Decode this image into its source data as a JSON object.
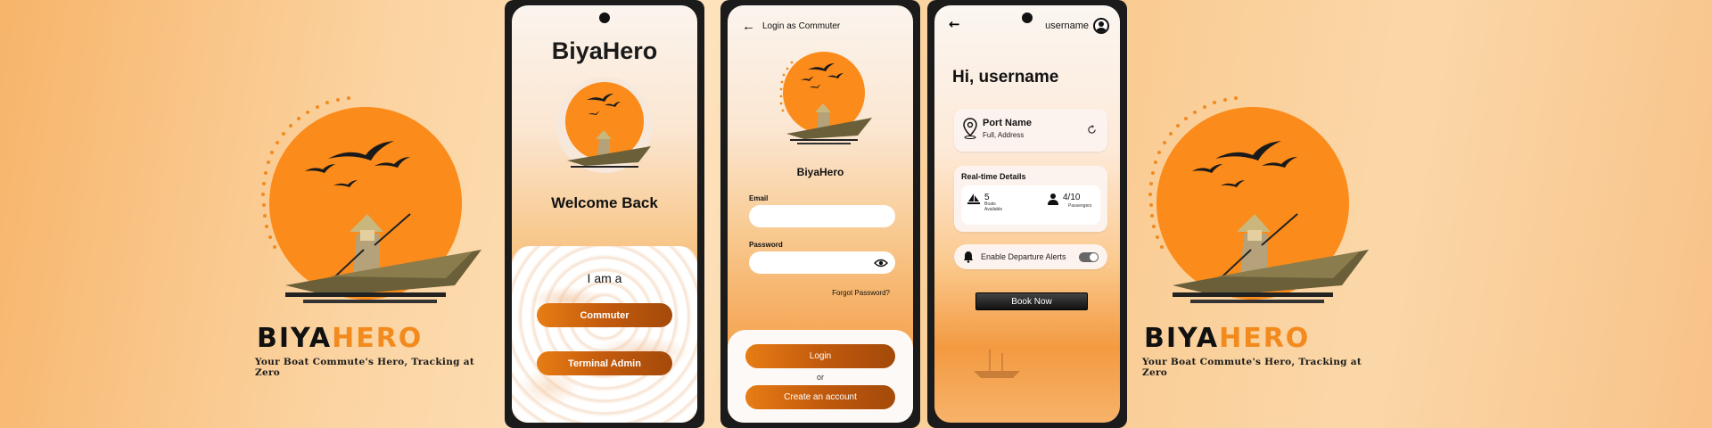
{
  "brand": {
    "word_part1": "BIYA",
    "word_part2": "HERO",
    "tagline": "Your Boat Commute's Hero, Tracking at Zero",
    "colors": {
      "orange": "#f28a1e",
      "dark": "#111111"
    }
  },
  "screen_role": {
    "app_title": "BiyaHero",
    "welcome": "Welcome Back",
    "prompt": "I am a",
    "buttons": [
      "Commuter",
      "Terminal Admin"
    ]
  },
  "screen_login": {
    "header": "Login as Commuter",
    "back_icon": "arrow-left-icon",
    "brand_label": "BiyaHero",
    "email_label": "Email",
    "email_value": "",
    "password_label": "Password",
    "password_value": "",
    "show_password_icon": "eye-icon",
    "forgot": "Forgot Password?",
    "login_button": "Login",
    "or": "or",
    "create_button": "Create an account"
  },
  "screen_home": {
    "back_icon": "arrow-left-icon",
    "username": "username",
    "greeting": "Hi, username",
    "port": {
      "name": "Port Name",
      "address": "Full, Address",
      "refresh_icon": "refresh-icon",
      "pin_icon": "location-pin-icon"
    },
    "realtime": {
      "title": "Real-time Details",
      "boats": {
        "value": "5",
        "label1": "Boats",
        "label2": "Available"
      },
      "passengers": {
        "value": "4/10",
        "label": "Passengers"
      }
    },
    "alerts_label": "Enable Departure Alerts",
    "alerts_enabled": true,
    "book_button": "Book Now"
  }
}
